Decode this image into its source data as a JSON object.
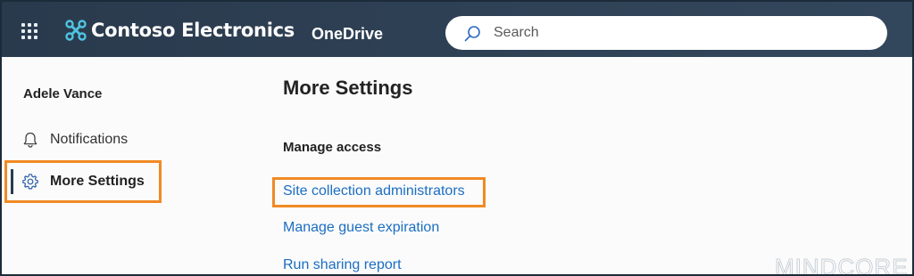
{
  "header": {
    "brand_name": "Contoso Electronics",
    "app_name": "OneDrive",
    "search": {
      "placeholder": "Search",
      "value": ""
    },
    "colors": {
      "background": "#2c3e50",
      "text": "#ffffff"
    },
    "icons": [
      "waffle-icon",
      "contoso-logo-icon",
      "search-icon"
    ]
  },
  "sidebar": {
    "user_name": "Adele Vance",
    "items": [
      {
        "label": "Notifications",
        "icon": "bell-icon",
        "active": false
      },
      {
        "label": "More Settings",
        "icon": "gear-icon",
        "active": true
      }
    ]
  },
  "main": {
    "title": "More Settings",
    "section_heading": "Manage access",
    "links": [
      {
        "label": "Site collection administrators",
        "highlighted": true
      },
      {
        "label": "Manage guest expiration",
        "highlighted": false
      },
      {
        "label": "Run sharing report",
        "highlighted": false
      }
    ]
  },
  "annotation": {
    "highlight_color": "#f08a24"
  },
  "watermark": {
    "text": "MINDCORE"
  }
}
